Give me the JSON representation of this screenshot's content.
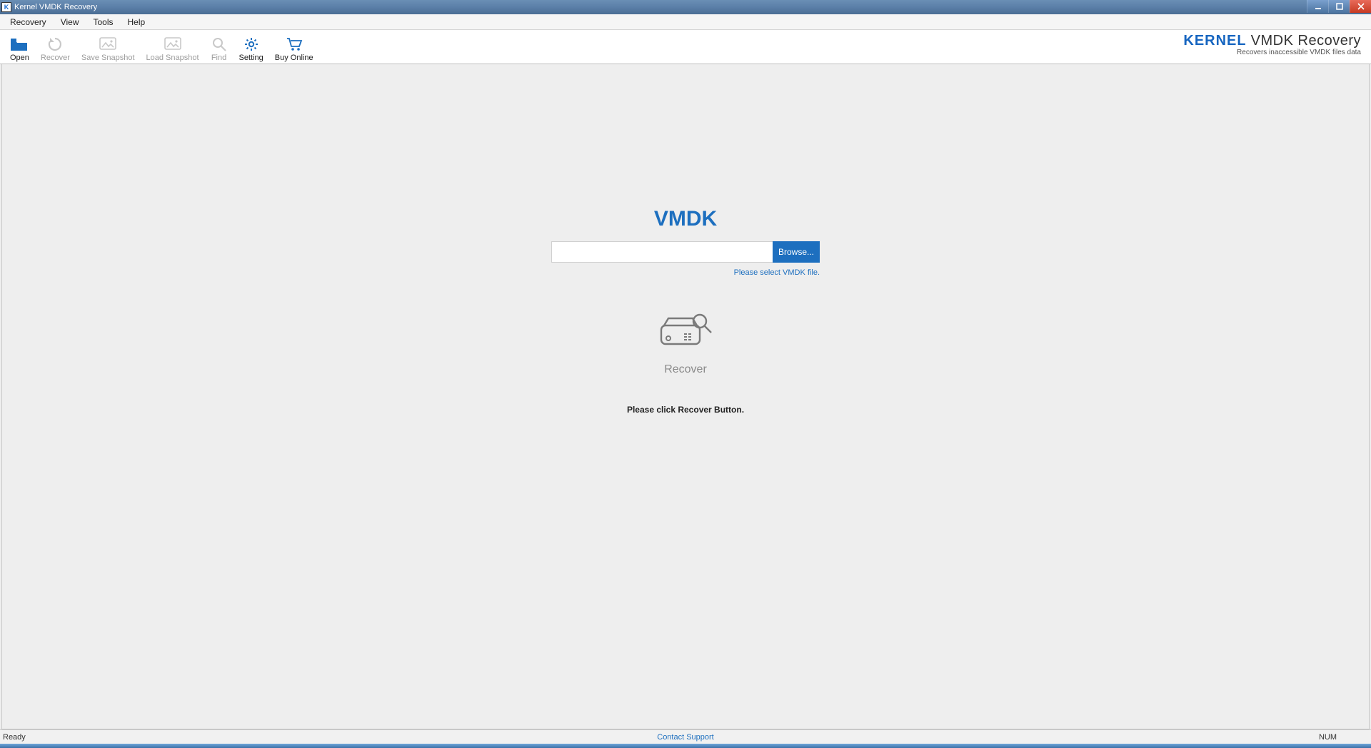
{
  "window": {
    "title": "Kernel VMDK Recovery"
  },
  "menu": {
    "items": [
      "Recovery",
      "View",
      "Tools",
      "Help"
    ]
  },
  "toolbar": {
    "open": {
      "label": "Open",
      "enabled": true
    },
    "recover": {
      "label": "Recover",
      "enabled": false
    },
    "save_snapshot": {
      "label": "Save Snapshot",
      "enabled": false
    },
    "load_snapshot": {
      "label": "Load Snapshot",
      "enabled": false
    },
    "find": {
      "label": "Find",
      "enabled": false
    },
    "setting": {
      "label": "Setting",
      "enabled": true
    },
    "buy_online": {
      "label": "Buy Online",
      "enabled": true
    }
  },
  "brand": {
    "name_bold": "KERNEL",
    "name_rest": " VMDK Recovery",
    "tagline": "Recovers inaccessible VMDK files data"
  },
  "main": {
    "heading": "VMDK",
    "path_value": "",
    "browse_label": "Browse...",
    "hint": "Please select VMDK file.",
    "recover_label": "Recover",
    "recover_note": "Please click Recover Button."
  },
  "status": {
    "left": "Ready",
    "center": "Contact Support",
    "right": "NUM"
  },
  "colors": {
    "accent": "#1d6fbf"
  }
}
